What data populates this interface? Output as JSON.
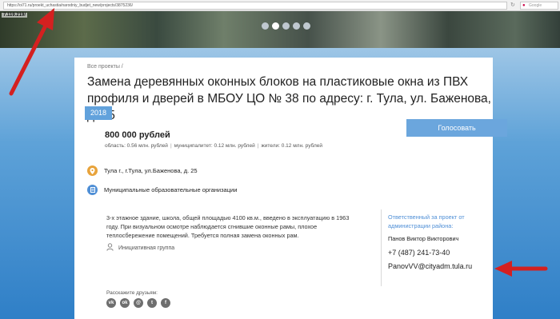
{
  "browser": {
    "url": "https://oi71.ru/proekt_uchastia/narodniy_budjet_new/projects/3875236/",
    "search_placeholder": "Google"
  },
  "hero": {
    "ip_label": "7.119.219/",
    "slider_dots": 5,
    "active_dot": 1
  },
  "project": {
    "breadcrumb": "Все проекты /",
    "title": "Замена деревянных оконных блоков на пластиковые окна из ПВХ профиля и дверей в МБОУ ЦО № 38 по адресу: г. Тула, ул. Баженова, д. 25",
    "year": "2018",
    "amount": "800 000 рублей",
    "breakdown": {
      "region": "область: 0.56 млн. рублей",
      "municipality": "муниципалитет: 0.12 млн. рублей",
      "residents": "жители: 0.12 млн. рублей"
    },
    "vote_label": "Голосовать",
    "location": "Тула г., г.Тула, ул.Баженова, д. 25",
    "category": "Муниципальные образовательные организации",
    "description": "3-х этажное здание, школа, общей площадью 4100 кв.м., введено в эксплуатацию в 1963 году. При визуальном осмотре наблюдается сгнившие оконные рамы, плохое теплосбережение помещений. Требуется полная замена оконных рам.",
    "initiative_label": "Инициативная группа"
  },
  "responsible": {
    "title": "Ответственный за проект от администрации района:",
    "name": "Панов Виктор Викторович",
    "phone": "+7 (487) 241-73-40",
    "email": "PanovVV@cityadm.tula.ru"
  },
  "share": {
    "label": "Расскажите друзьям:",
    "networks": [
      {
        "name": "vk",
        "glyph": "vk"
      },
      {
        "name": "odnoklassniki",
        "glyph": "ok"
      },
      {
        "name": "moimir",
        "glyph": "@"
      },
      {
        "name": "twitter",
        "glyph": "t"
      },
      {
        "name": "facebook",
        "glyph": "f"
      }
    ]
  },
  "colors": {
    "accent": "#62a2dc",
    "vote_button": "#6ba6dd",
    "location_icon": "#e8a33b",
    "annotation_arrow": "#d42020"
  }
}
